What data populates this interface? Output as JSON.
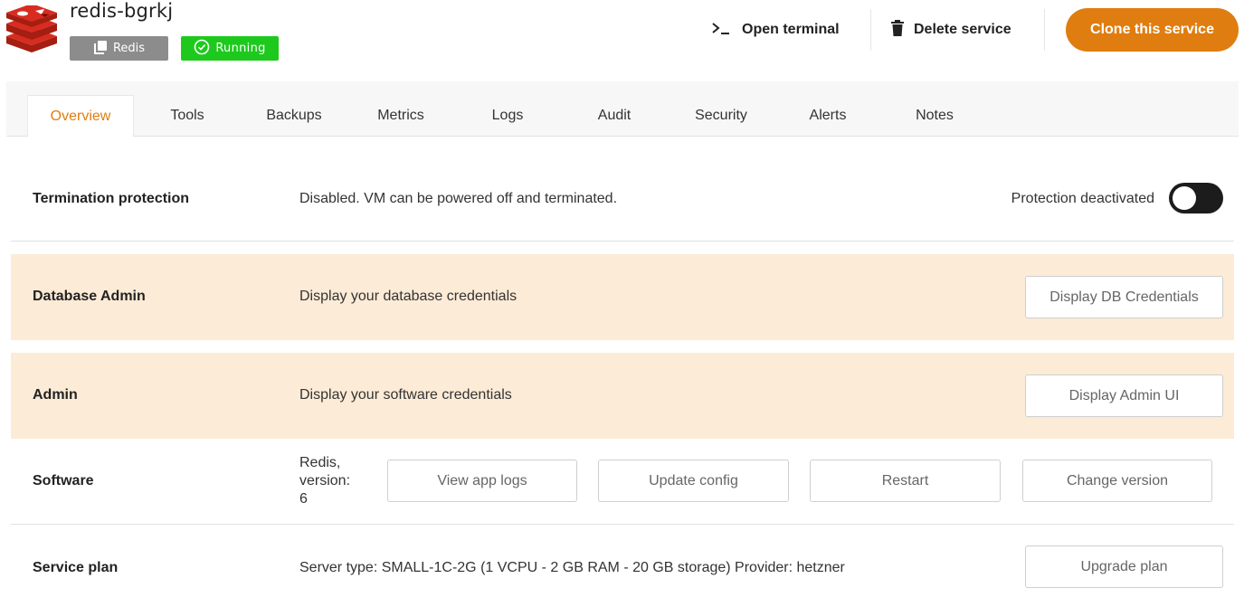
{
  "header": {
    "service_name": "redis-bgrkj",
    "software_badge": "Redis",
    "status_badge": "Running",
    "actions": {
      "open_terminal": "Open terminal",
      "delete_service": "Delete service",
      "clone_service": "Clone this service"
    },
    "colors": {
      "accent": "#e07d10",
      "running": "#1ec91e",
      "badge_gray": "#8c8c8c"
    }
  },
  "tabs": [
    {
      "label": "Overview",
      "active": true
    },
    {
      "label": "Tools"
    },
    {
      "label": "Backups"
    },
    {
      "label": "Metrics"
    },
    {
      "label": "Logs"
    },
    {
      "label": "Audit"
    },
    {
      "label": "Security"
    },
    {
      "label": "Alerts"
    },
    {
      "label": "Notes"
    }
  ],
  "rows": {
    "termination": {
      "label": "Termination protection",
      "description": "Disabled. VM can be powered off and terminated.",
      "toggle_label": "Protection deactivated",
      "toggle_on": false
    },
    "db_admin": {
      "label": "Database Admin",
      "description": "Display your database credentials",
      "button": "Display DB Credentials"
    },
    "admin": {
      "label": "Admin",
      "description": "Display your software credentials",
      "button": "Display Admin UI"
    },
    "software": {
      "label": "Software",
      "version_lines": [
        "Redis,",
        "version:",
        "6"
      ],
      "buttons": [
        "View app logs",
        "Update config",
        "Restart",
        "Change version"
      ]
    },
    "service_plan": {
      "label": "Service plan",
      "description": "Server type: SMALL-1C-2G (1 VCPU - 2 GB RAM - 20 GB storage) Provider: hetzner",
      "button": "Upgrade plan"
    }
  }
}
